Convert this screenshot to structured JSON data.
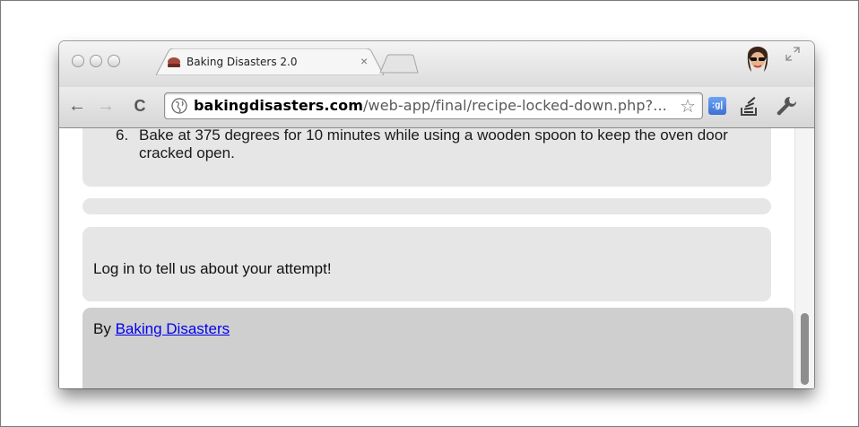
{
  "tab": {
    "title": "Baking Disasters 2.0",
    "close": "×"
  },
  "toolbar": {
    "back": "←",
    "forward": "→",
    "reload": "C",
    "url_host": "bakingdisasters.com",
    "url_path": "/web-app/final/recipe-locked-down.php?...",
    "bookmark": "☆",
    "google_ext": ":g|"
  },
  "content": {
    "step_number": "6.",
    "step_text": "Bake at 375 degrees for 10 minutes while using a wooden spoon to keep the oven door cracked open.",
    "login_prompt": "Log in to tell us about your attempt!",
    "byline_prefix": "By ",
    "byline_link": "Baking Disasters"
  }
}
